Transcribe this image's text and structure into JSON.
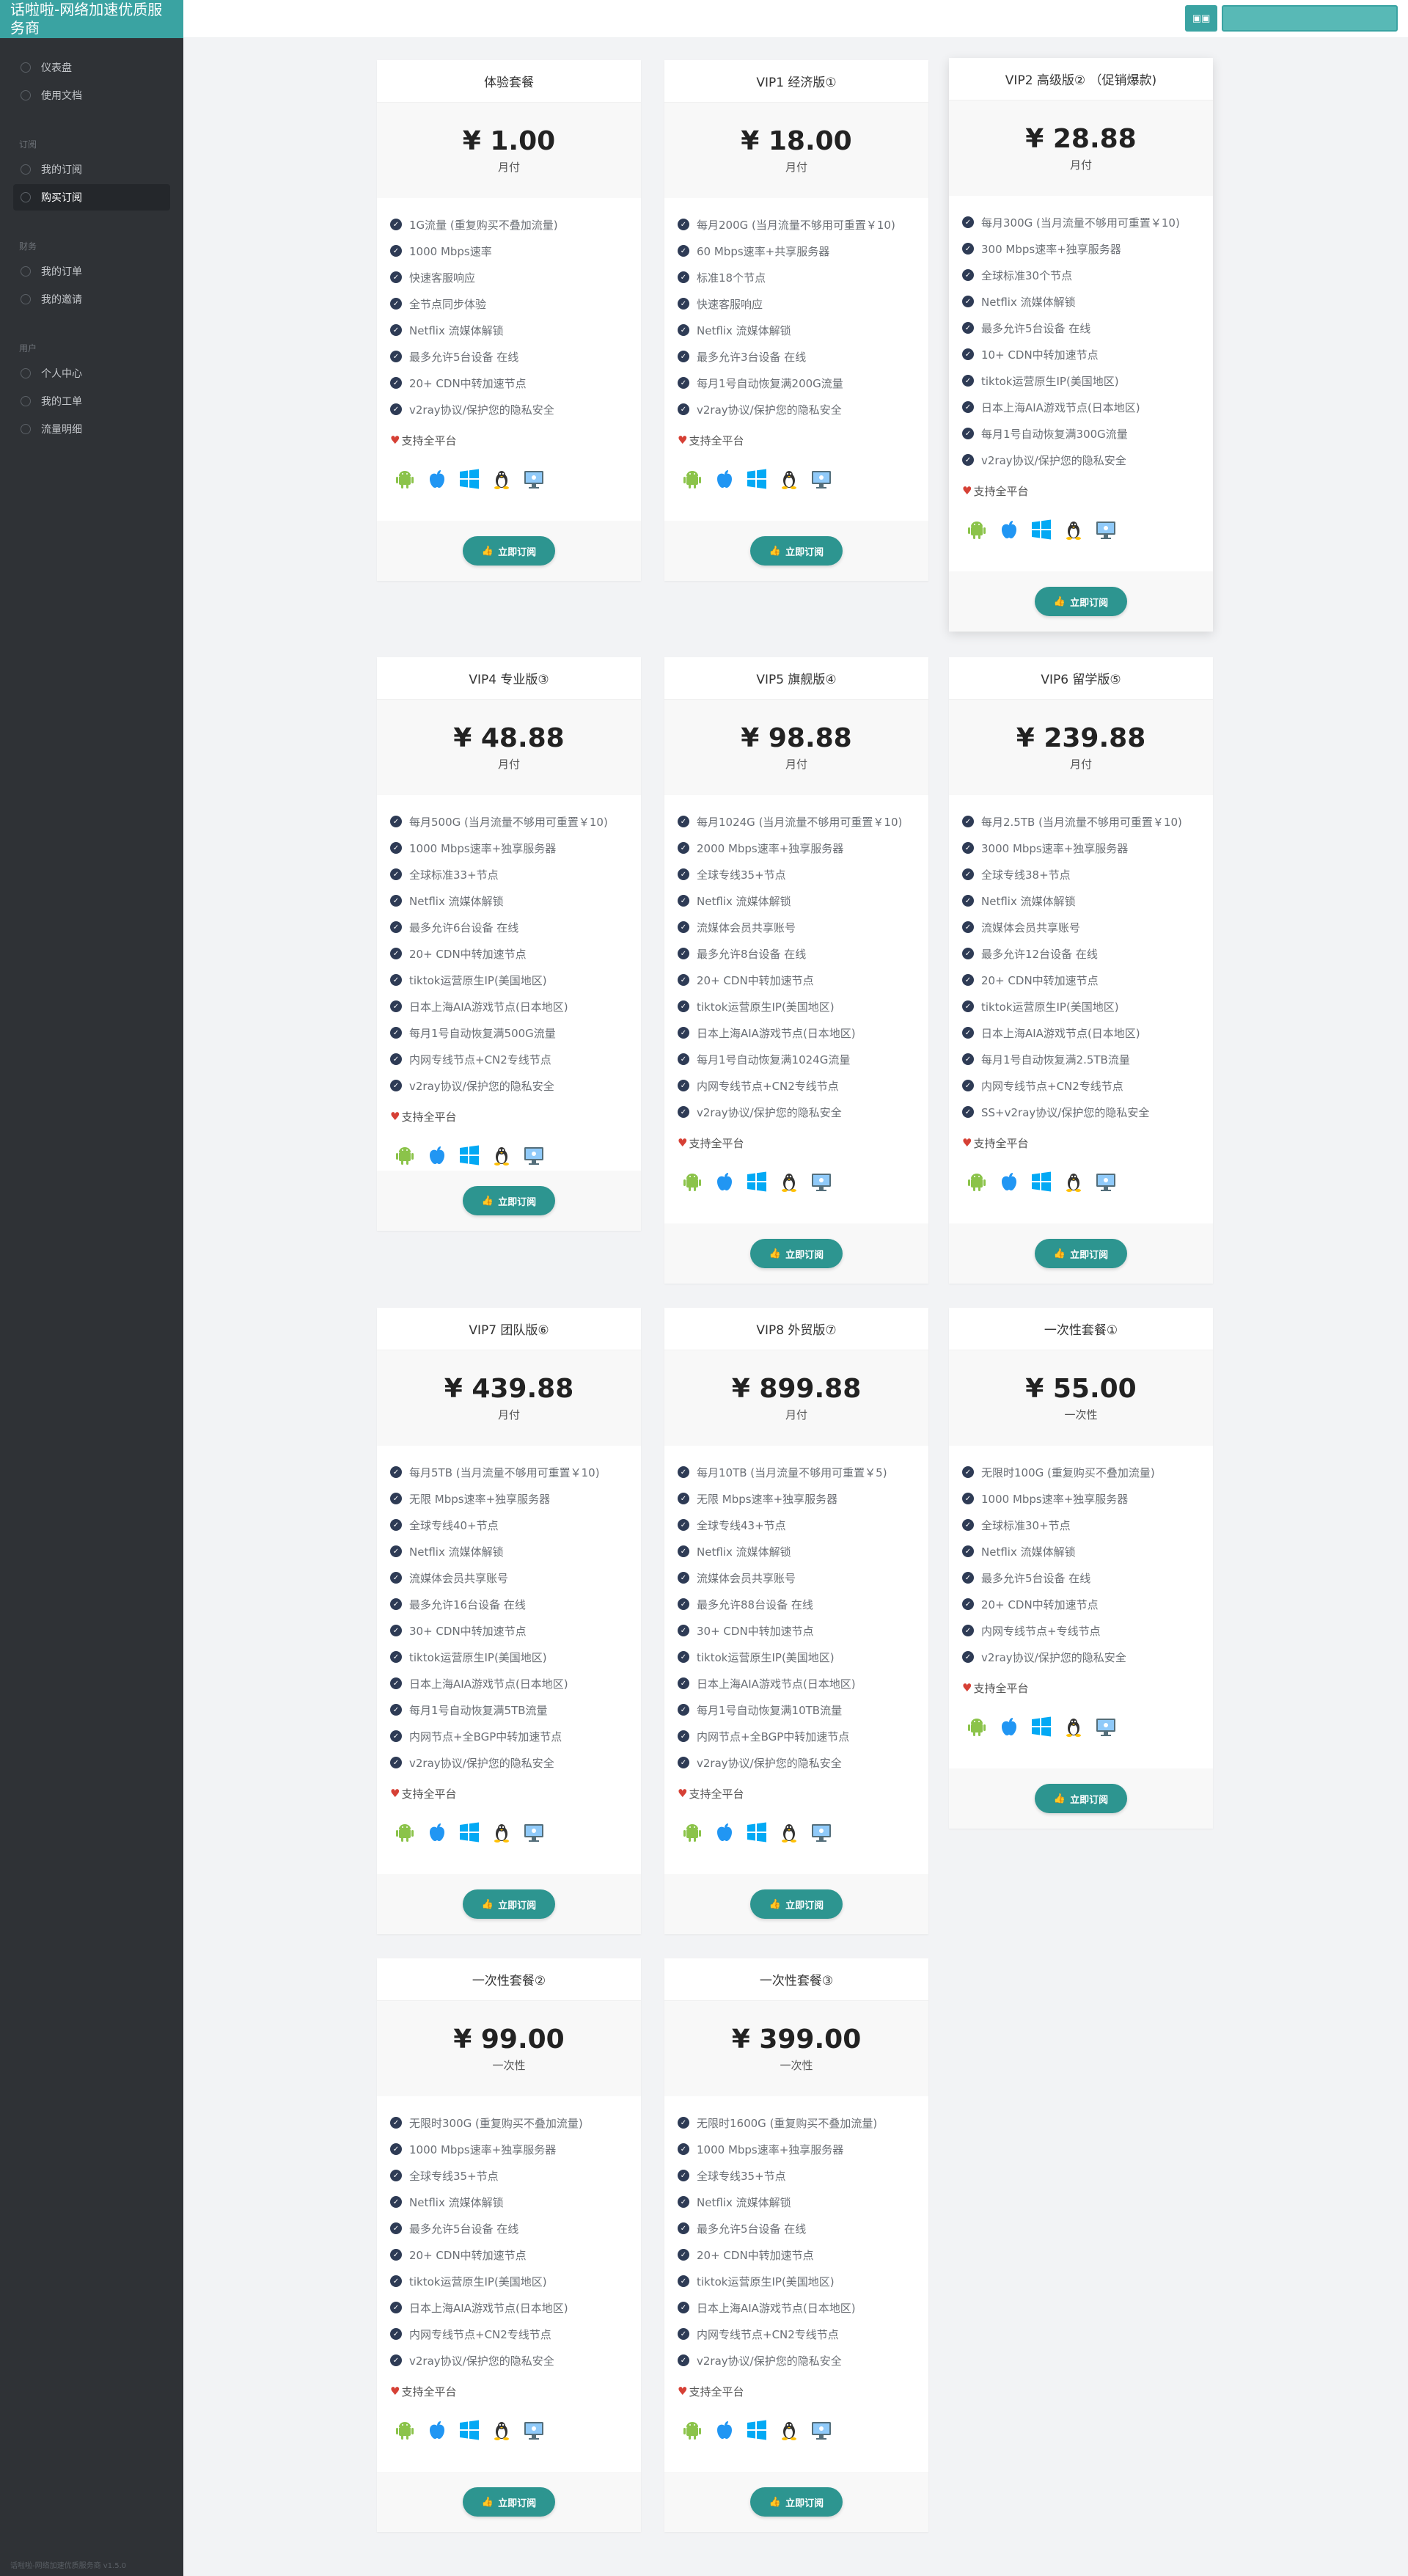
{
  "brand": "话啦啦-网络加速优质服务商",
  "footer": "话啦啦-网络加速优质服务商 v1.5.0",
  "topbar": {
    "lang_button": "▣▣"
  },
  "nav": {
    "items_top": [
      {
        "label": "仪表盘"
      },
      {
        "label": "使用文档"
      }
    ],
    "section_subscribe": "订阅",
    "items_subscribe": [
      {
        "label": "我的订阅"
      },
      {
        "label": "购买订阅"
      }
    ],
    "section_finance": "财务",
    "items_finance": [
      {
        "label": "我的订单"
      },
      {
        "label": "我的邀请"
      }
    ],
    "section_user": "用户",
    "items_user": [
      {
        "label": "个人中心"
      },
      {
        "label": "我的工单"
      },
      {
        "label": "流量明细"
      }
    ]
  },
  "common": {
    "support_label": "支持全平台",
    "subscribe_label": "立即订阅",
    "platform_icons": [
      "android-icon",
      "apple-icon",
      "windows-icon",
      "linux-icon",
      "desktop-icon"
    ]
  },
  "plans": [
    {
      "title": "体验套餐",
      "price": "¥ 1.00",
      "period": "月付",
      "features": [
        "1G流量 (重复购买不叠加流量)",
        "1000 Mbps速率",
        "快速客服响应",
        "全节点同步体验",
        "Netflix 流媒体解锁",
        "最多允许5台设备 在线",
        "20+ CDN中转加速节点",
        "v2ray协议/保护您的隐私安全"
      ]
    },
    {
      "title": "VIP1 经济版①",
      "price": "¥ 18.00",
      "period": "月付",
      "features": [
        "每月200G (当月流量不够用可重置￥10)",
        "60 Mbps速率+共享服务器",
        "标准18个节点",
        "快速客服响应",
        "Netflix 流媒体解锁",
        "最多允许3台设备 在线",
        "每月1号自动恢复满200G流量",
        "v2ray协议/保护您的隐私安全"
      ]
    },
    {
      "title": "VIP2 高级版② （促销爆款)",
      "price": "¥ 28.88",
      "period": "月付",
      "features": [
        "每月300G (当月流量不够用可重置￥10)",
        "300 Mbps速率+独享服务器",
        "全球标准30个节点",
        "Netflix 流媒体解锁",
        "最多允许5台设备 在线",
        "10+ CDN中转加速节点",
        "tiktok运营原生IP(美国地区)",
        "日本上海AIA游戏节点(日本地区)",
        "每月1号自动恢复满300G流量",
        "v2ray协议/保护您的隐私安全"
      ]
    },
    {
      "title": "VIP4 专业版③",
      "price": "¥ 48.88",
      "period": "月付",
      "features": [
        "每月500G (当月流量不够用可重置￥10)",
        "1000 Mbps速率+独享服务器",
        "全球标准33+节点",
        "Netflix 流媒体解锁",
        "最多允许6台设备 在线",
        "20+ CDN中转加速节点",
        "tiktok运营原生IP(美国地区)",
        "日本上海AIA游戏节点(日本地区)",
        "每月1号自动恢复满500G流量",
        "内网专线节点+CN2专线节点",
        "v2ray协议/保护您的隐私安全"
      ]
    },
    {
      "title": "VIP5 旗舰版④",
      "price": "¥ 98.88",
      "period": "月付",
      "features": [
        "每月1024G (当月流量不够用可重置￥10)",
        "2000 Mbps速率+独享服务器",
        "全球专线35+节点",
        "Netflix 流媒体解锁",
        "流媒体会员共享账号",
        "最多允许8台设备 在线",
        "20+ CDN中转加速节点",
        "tiktok运营原生IP(美国地区)",
        "日本上海AIA游戏节点(日本地区)",
        "每月1号自动恢复满1024G流量",
        "内网专线节点+CN2专线节点",
        "v2ray协议/保护您的隐私安全"
      ]
    },
    {
      "title": "VIP6 留学版⑤",
      "price": "¥ 239.88",
      "period": "月付",
      "features": [
        "每月2.5TB (当月流量不够用可重置￥10)",
        "3000 Mbps速率+独享服务器",
        "全球专线38+节点",
        "Netflix 流媒体解锁",
        "流媒体会员共享账号",
        "最多允许12台设备 在线",
        "20+ CDN中转加速节点",
        "tiktok运营原生IP(美国地区)",
        "日本上海AIA游戏节点(日本地区)",
        "每月1号自动恢复满2.5TB流量",
        "内网专线节点+CN2专线节点",
        "SS+v2ray协议/保护您的隐私安全"
      ]
    },
    {
      "title": "VIP7 团队版⑥",
      "price": "¥ 439.88",
      "period": "月付",
      "features": [
        "每月5TB (当月流量不够用可重置￥10)",
        "无限 Mbps速率+独享服务器",
        "全球专线40+节点",
        "Netflix 流媒体解锁",
        "流媒体会员共享账号",
        "最多允许16台设备 在线",
        "30+ CDN中转加速节点",
        "tiktok运营原生IP(美国地区)",
        "日本上海AIA游戏节点(日本地区)",
        "每月1号自动恢复满5TB流量",
        "内网节点+全BGP中转加速节点",
        "v2ray协议/保护您的隐私安全"
      ]
    },
    {
      "title": "VIP8 外贸版⑦",
      "price": "¥ 899.88",
      "period": "月付",
      "features": [
        "每月10TB (当月流量不够用可重置￥5)",
        "无限 Mbps速率+独享服务器",
        "全球专线43+节点",
        "Netflix 流媒体解锁",
        "流媒体会员共享账号",
        "最多允许88台设备 在线",
        "30+ CDN中转加速节点",
        "tiktok运营原生IP(美国地区)",
        "日本上海AIA游戏节点(日本地区)",
        "每月1号自动恢复满10TB流量",
        "内网节点+全BGP中转加速节点",
        "v2ray协议/保护您的隐私安全"
      ]
    },
    {
      "title": "一次性套餐①",
      "price": "¥ 55.00",
      "period": "一次性",
      "features": [
        "无限时100G (重复购买不叠加流量)",
        "1000 Mbps速率+独享服务器",
        "全球标准30+节点",
        "Netflix 流媒体解锁",
        "最多允许5台设备 在线",
        "20+ CDN中转加速节点",
        "内网专线节点+专线节点",
        "v2ray协议/保护您的隐私安全"
      ]
    },
    {
      "title": "一次性套餐②",
      "price": "¥ 99.00",
      "period": "一次性",
      "features": [
        "无限时300G (重复购买不叠加流量)",
        "1000 Mbps速率+独享服务器",
        "全球专线35+节点",
        "Netflix 流媒体解锁",
        "最多允许5台设备 在线",
        "20+ CDN中转加速节点",
        "tiktok运营原生IP(美国地区)",
        "日本上海AIA游戏节点(日本地区)",
        "内网专线节点+CN2专线节点",
        "v2ray协议/保护您的隐私安全"
      ]
    },
    {
      "title": "一次性套餐③",
      "price": "¥ 399.00",
      "period": "一次性",
      "features": [
        "无限时1600G (重复购买不叠加流量)",
        "1000 Mbps速率+独享服务器",
        "全球专线35+节点",
        "Netflix 流媒体解锁",
        "最多允许5台设备 在线",
        "20+ CDN中转加速节点",
        "tiktok运营原生IP(美国地区)",
        "日本上海AIA游戏节点(日本地区)",
        "内网专线节点+CN2专线节点",
        "v2ray协议/保护您的隐私安全"
      ]
    }
  ]
}
